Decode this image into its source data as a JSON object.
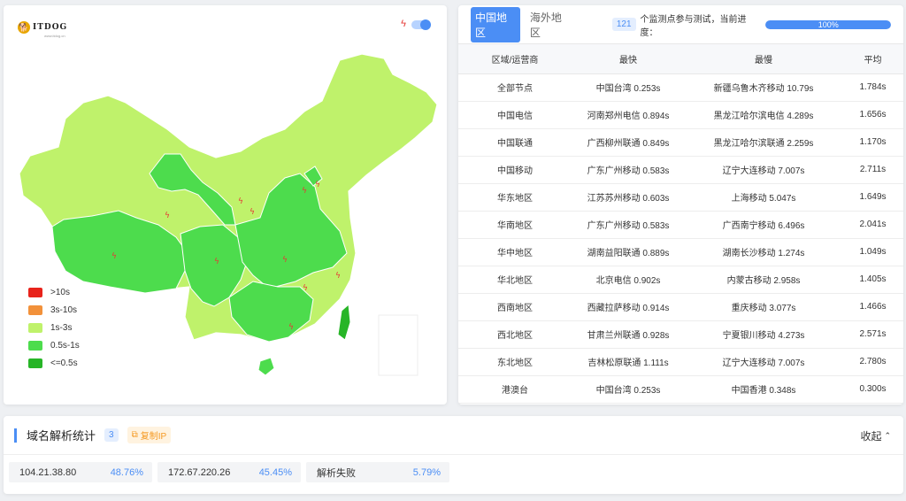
{
  "logo": {
    "name": "ITDOG",
    "subtitle": "www.itdog.cn"
  },
  "legend": [
    {
      "label": ">10s",
      "color": "#e8231b"
    },
    {
      "label": "3s-10s",
      "color": "#f2913a"
    },
    {
      "label": "1s-3s",
      "color": "#bff26b"
    },
    {
      "label": "0.5s-1s",
      "color": "#4ddc4d"
    },
    {
      "label": "<=0.5s",
      "color": "#27b527"
    }
  ],
  "tabs": {
    "china": "中国地区",
    "overseas": "海外地区"
  },
  "progress": {
    "count": "121",
    "text": "个监测点参与测试，当前进度：",
    "label": "100%",
    "percent": 100
  },
  "table": {
    "headers": [
      "区域/运营商",
      "最快",
      "最慢",
      "平均"
    ],
    "rows": [
      [
        "全部节点",
        "中国台湾 0.253s",
        "新疆乌鲁木齐移动 10.79s",
        "1.784s"
      ],
      [
        "中国电信",
        "河南郑州电信 0.894s",
        "黑龙江哈尔滨电信 4.289s",
        "1.656s"
      ],
      [
        "中国联通",
        "广西柳州联通 0.849s",
        "黑龙江哈尔滨联通 2.259s",
        "1.170s"
      ],
      [
        "中国移动",
        "广东广州移动 0.583s",
        "辽宁大连移动 7.007s",
        "2.711s"
      ],
      [
        "华东地区",
        "江苏苏州移动 0.603s",
        "上海移动 5.047s",
        "1.649s"
      ],
      [
        "华南地区",
        "广东广州移动 0.583s",
        "广西南宁移动 6.496s",
        "2.041s"
      ],
      [
        "华中地区",
        "湖南益阳联通 0.889s",
        "湖南长沙移动 1.274s",
        "1.049s"
      ],
      [
        "华北地区",
        "北京电信 0.902s",
        "内蒙古移动 2.958s",
        "1.405s"
      ],
      [
        "西南地区",
        "西藏拉萨移动 0.914s",
        "重庆移动 3.077s",
        "1.466s"
      ],
      [
        "西北地区",
        "甘肃兰州联通 0.928s",
        "宁夏银川移动 4.273s",
        "2.571s"
      ],
      [
        "东北地区",
        "吉林松原联通 1.111s",
        "辽宁大连移动 7.007s",
        "2.780s"
      ],
      [
        "港澳台",
        "中国台湾 0.253s",
        "中国香港 0.348s",
        "0.300s"
      ]
    ]
  },
  "dns": {
    "title": "域名解析统计",
    "count": "3",
    "copy_label": "复制IP",
    "collapse_label": "收起",
    "items": [
      {
        "ip": "104.21.38.80",
        "pct": "48.76%"
      },
      {
        "ip": "172.67.220.26",
        "pct": "45.45%"
      },
      {
        "ip": "解析失败",
        "pct": "5.79%"
      }
    ]
  }
}
